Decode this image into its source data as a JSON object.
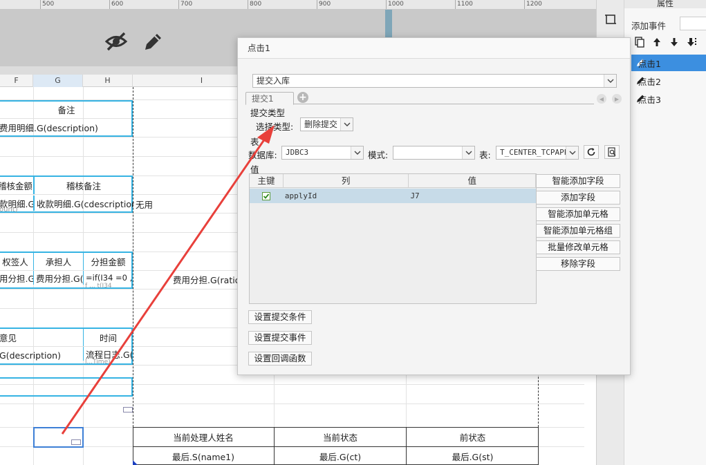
{
  "ruler": {
    "ticks": [
      "500",
      "600",
      "700",
      "800",
      "900",
      "1000",
      "1100",
      "1200"
    ]
  },
  "columns": [
    "F",
    "G",
    "H",
    "I"
  ],
  "sheet": {
    "remark_header": "备注",
    "remark_value": "费用明细.G(description)",
    "verify_amount": "稽核金额",
    "verify_remark": "稽核备注",
    "verify_amount_val": "款明细.G(",
    "verify_amount_val2": "ount)",
    "verify_remark_val": "收款明细.G(cdescription)",
    "unused": "无用",
    "signer": "权签人",
    "bearer": "承担人",
    "share_amount": "分担金额",
    "signer_val": "用分担.G(",
    "bearer_val": "费用分担.G(",
    "share_val": "=if(I34 =0 ,",
    "share_val2": "f ... t(I34",
    "ratio_val": "费用分担.G(ratio)",
    "opinion": "意见",
    "time": "时间",
    "opinion_val": "G(description)",
    "time_val": "流程日志.G(",
    "time_val2": "l...Time)",
    "handler_name": "当前处理人姓名",
    "current_state": "当前状态",
    "prev_state": "前状态",
    "handler_val": "最后.S(name1)",
    "current_val": "最后.G(ct)",
    "prev_val": "最后.G(st)"
  },
  "props_panel": {
    "title": "属性",
    "add_event": "添加事件",
    "events": [
      {
        "label": "点击1",
        "active": true
      },
      {
        "label": "点击2",
        "active": false
      },
      {
        "label": "点击3",
        "active": false
      }
    ]
  },
  "dialog": {
    "title": "点击1",
    "action_select": "提交入库",
    "tab_label": "提交1",
    "submit_type_section": "提交类型",
    "select_type_label": "选择类型:",
    "select_type_value": "删除提交",
    "table_section": "表",
    "db_label": "数据库:",
    "db_value": "JDBC3",
    "schema_label": "模式:",
    "schema_value": "",
    "table_label": "表:",
    "table_value": "T_CENTER_TCPAPPI",
    "value_section": "值",
    "value_table": {
      "headers": [
        "主键",
        "列",
        "值"
      ],
      "rows": [
        {
          "key": true,
          "column": "applyId",
          "value": "J7"
        }
      ]
    },
    "side_buttons": [
      "智能添加字段",
      "添加字段",
      "智能添加单元格",
      "智能添加单元格组",
      "批量修改单元格",
      "移除字段"
    ],
    "bottom_buttons": [
      "设置提交条件",
      "设置提交事件",
      "设置回调函数"
    ]
  },
  "colors": {
    "accent": "#3c8fe0",
    "cell_border": "#35b3e3",
    "annotation_arrow": "#e8403b"
  }
}
